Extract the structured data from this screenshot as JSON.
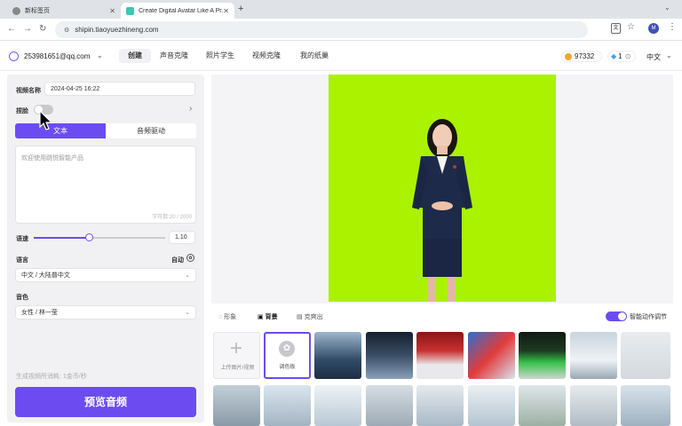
{
  "browser": {
    "tabs": [
      {
        "title": "新标签页"
      },
      {
        "title": "Create Digital Avatar Like A Pr..."
      }
    ],
    "url": "shipin.tiaoyuezhineng.com"
  },
  "header": {
    "account": "253981651@qq.com",
    "nav": [
      "创建",
      "声音克隆",
      "照片学生",
      "视频克隆",
      "我的纸巢"
    ],
    "coins": "97332",
    "gems": "1",
    "language": "中文"
  },
  "form": {
    "video_name_label": "视频名称",
    "video_name_value": "2024-04-25 16:22",
    "face_label": "捏脸",
    "face_toggle_on": false,
    "mode_tabs": [
      "文本",
      "音频驱动"
    ],
    "textarea_placeholder": "欢迎使用跳悦智能产品",
    "char_count": "字符数:20 / 2000",
    "speed_label": "语速",
    "speed_value": "1.10",
    "speed_fraction": 0.42,
    "language_label": "语言",
    "auto_label": "自动",
    "language_value": "中文 / 大陆普中文",
    "voice_label": "音色",
    "voice_value": "女性 / 林一莹",
    "cost_text": "生成视频所消耗: 1金币/秒",
    "preview_button": "预览音频"
  },
  "bottom": {
    "tabs": [
      "形象",
      "背景",
      "克爽出"
    ],
    "smart_label": "智能动作调节",
    "smart_on": true,
    "upload_label": "上传图片/视频",
    "palette_label": "调色板"
  },
  "colors": {
    "accent": "#6c4cf0",
    "greenscreen": "#aaf200"
  }
}
